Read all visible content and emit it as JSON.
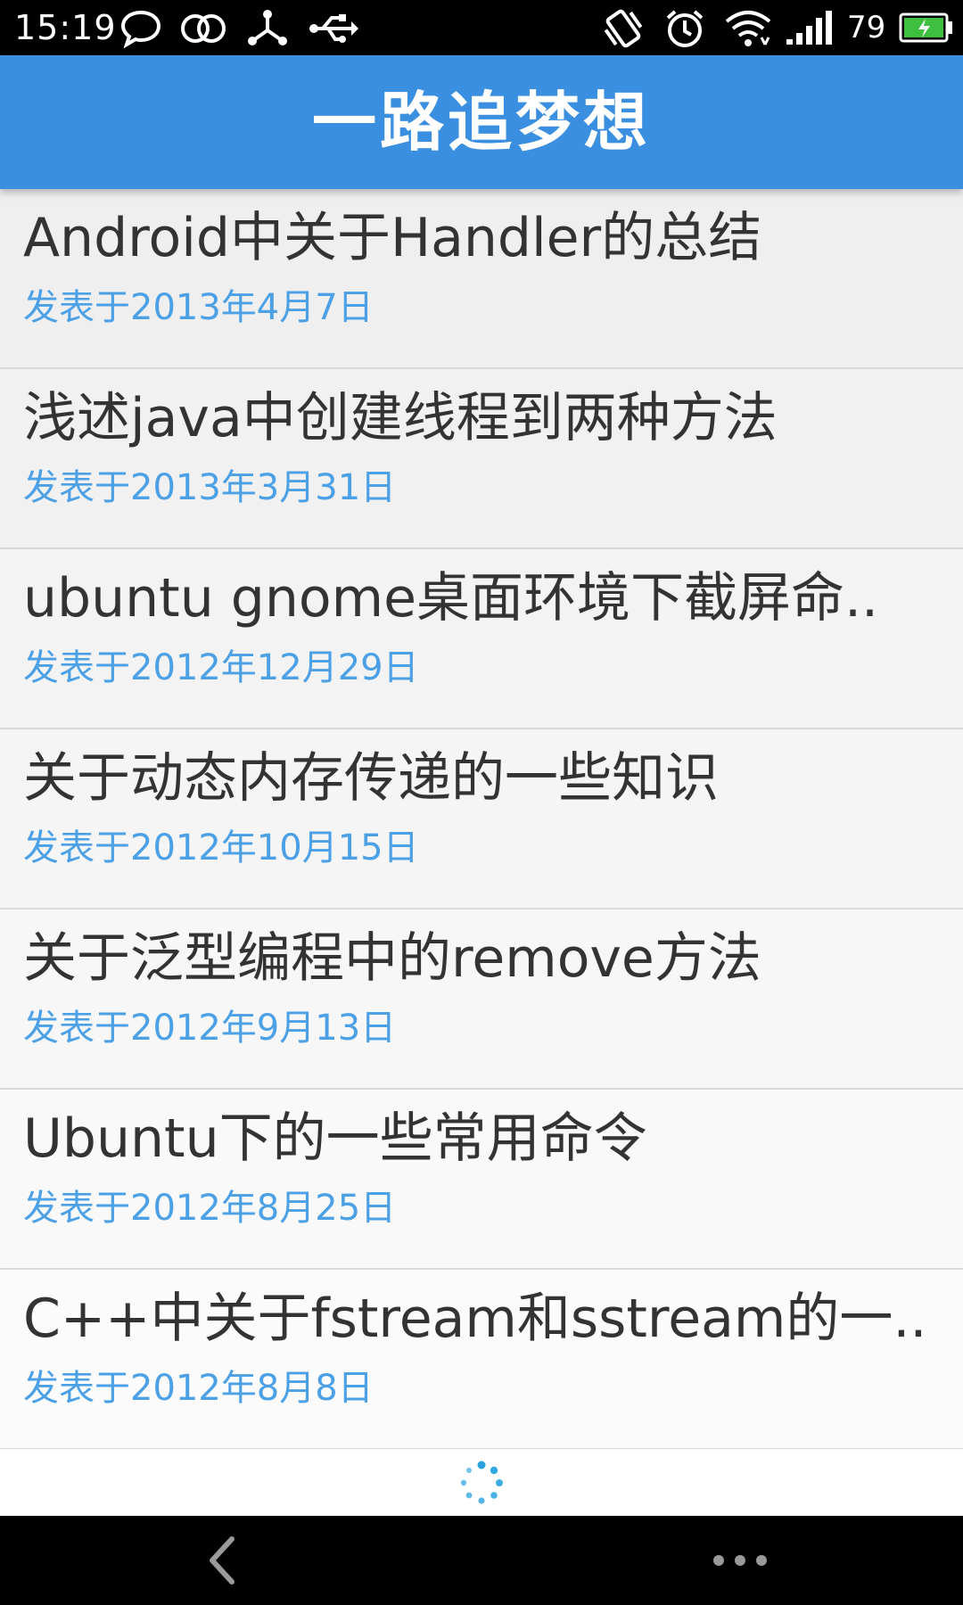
{
  "status_bar": {
    "time": "15:19",
    "battery_level": "79",
    "icons": [
      "chat-bubble-icon",
      "infinity-loop-icon",
      "share-node-icon",
      "usb-icon",
      "vibrate-icon",
      "alarm-icon",
      "wifi-icon",
      "signal-icon",
      "battery-charging-icon"
    ]
  },
  "app_bar": {
    "title": "一路追梦想",
    "color": "#3a8fe0"
  },
  "posts": [
    {
      "title": "Android中关于Handler的总结",
      "date": "发表于2013年4月7日"
    },
    {
      "title": "浅述java中创建线程到两种方法",
      "date": "发表于2013年3月31日"
    },
    {
      "title": "ubuntu gnome桌面环境下截屏命..",
      "date": "发表于2012年12月29日"
    },
    {
      "title": "关于动态内存传递的一些知识",
      "date": "发表于2012年10月15日"
    },
    {
      "title": "关于泛型编程中的remove方法",
      "date": "发表于2012年9月13日"
    },
    {
      "title": "Ubuntu下的一些常用命令",
      "date": "发表于2012年8月25日"
    },
    {
      "title": "C++中关于fstream和sstream的一..",
      "date": "发表于2012年8月8日"
    }
  ],
  "colors": {
    "date_text": "#4ca0e6",
    "title_text": "#333333",
    "spinner": "#29a3e0"
  },
  "nav_bar": {
    "icons": [
      "back-chevron-icon",
      "more-dots-icon"
    ]
  }
}
